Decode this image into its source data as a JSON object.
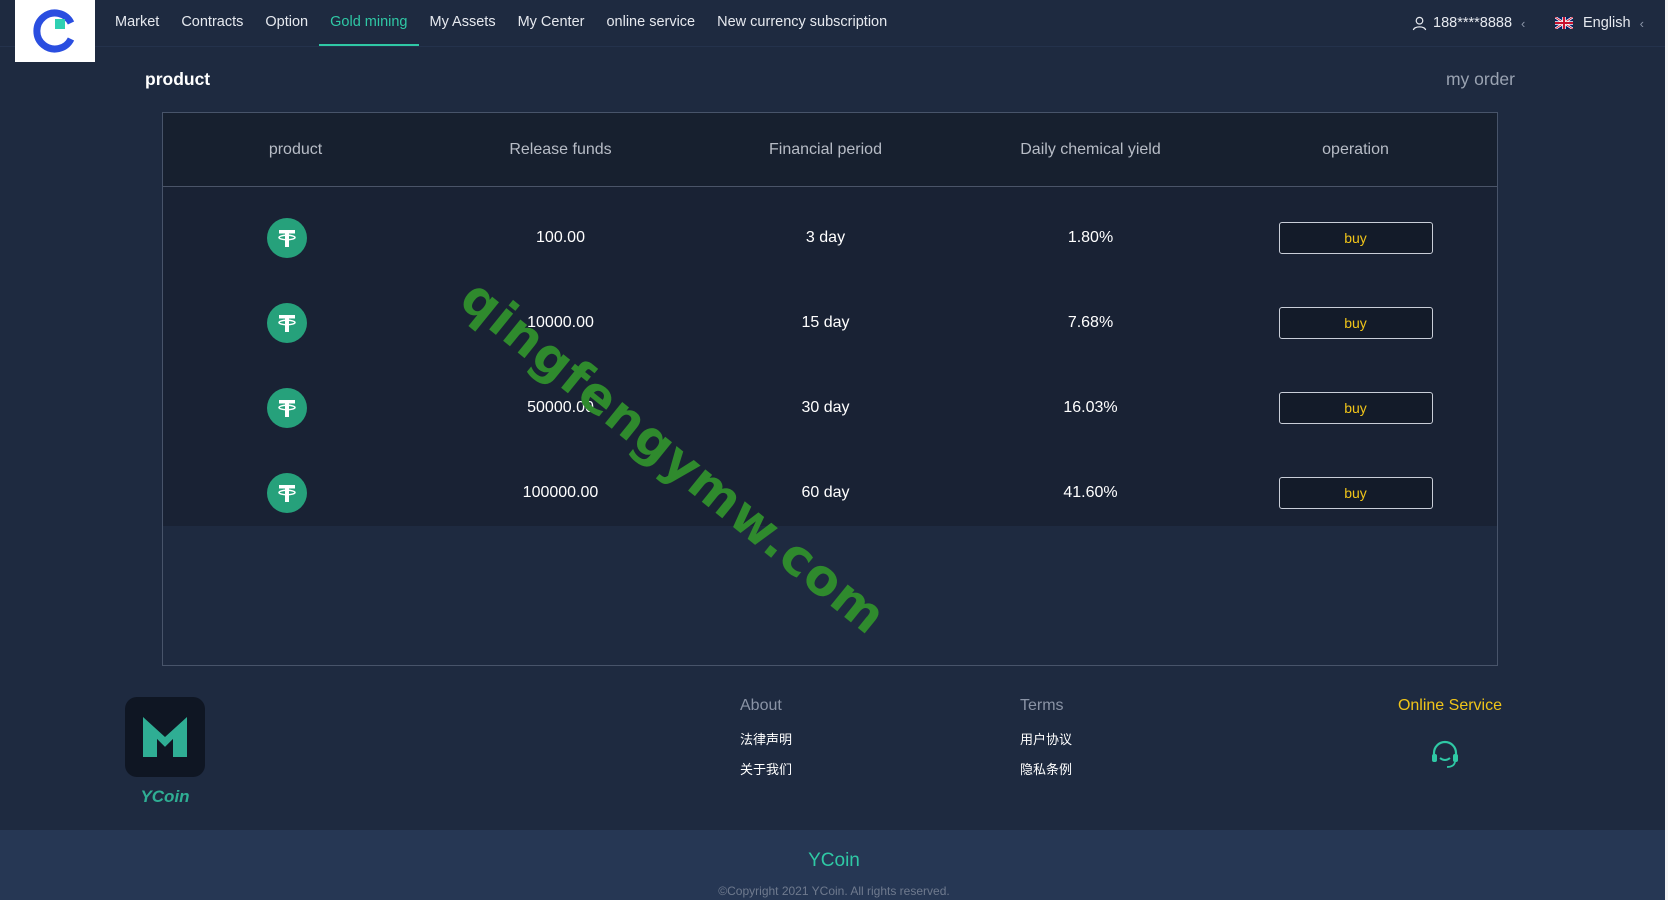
{
  "nav": {
    "items": [
      {
        "label": "Market"
      },
      {
        "label": "Contracts"
      },
      {
        "label": "Option"
      },
      {
        "label": "Gold mining",
        "active": true
      },
      {
        "label": "My Assets"
      },
      {
        "label": "My Center"
      },
      {
        "label": "online service"
      },
      {
        "label": "New currency subscription"
      }
    ],
    "user": "188****8888",
    "language": "English",
    "active_color": "#2fc8a5"
  },
  "page": {
    "title": "product",
    "my_order": "my order"
  },
  "table": {
    "columns": [
      "product",
      "Release funds",
      "Financial period",
      "Daily chemical yield",
      "operation"
    ],
    "rows": [
      {
        "icon": "tether-icon",
        "funds": "100.00",
        "period": "3 day",
        "yield": "1.80%",
        "action": "buy"
      },
      {
        "icon": "tether-icon",
        "funds": "10000.00",
        "period": "15 day",
        "yield": "7.68%",
        "action": "buy"
      },
      {
        "icon": "tether-icon",
        "funds": "50000.00",
        "period": "30 day",
        "yield": "16.03%",
        "action": "buy"
      },
      {
        "icon": "tether-icon",
        "funds": "100000.00",
        "period": "60 day",
        "yield": "41.60%",
        "action": "buy"
      }
    ]
  },
  "watermark": "qingfengymw.com",
  "footer": {
    "brand": "YCoin",
    "about": {
      "title": "About",
      "links": [
        "法律声明",
        "关于我们"
      ]
    },
    "terms": {
      "title": "Terms",
      "links": [
        "用户协议",
        "隐私条例"
      ]
    },
    "online_service": "Online Service",
    "site_name": "YCoin",
    "copyright": "©Copyright 2021 YCoin. All rights reserved."
  }
}
